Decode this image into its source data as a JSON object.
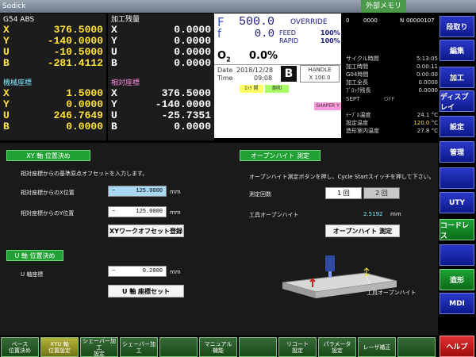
{
  "titlebar": {
    "app": "Sodick",
    "external_memory": "外部メモリ"
  },
  "coords": {
    "g54": {
      "header": "G54 ABS",
      "rows": [
        {
          "axis": "X",
          "value": "376.5000"
        },
        {
          "axis": "Y",
          "value": "-140.0000"
        },
        {
          "axis": "U",
          "value": "-10.5000"
        },
        {
          "axis": "B",
          "value": "-281.4112"
        }
      ]
    },
    "remaining": {
      "header": "加工残量",
      "rows": [
        {
          "axis": "X",
          "value": "0.0000"
        },
        {
          "axis": "Y",
          "value": "0.0000"
        },
        {
          "axis": "U",
          "value": "0.0000"
        },
        {
          "axis": "B",
          "value": "0.0000"
        }
      ]
    },
    "machine": {
      "header": "機械座標",
      "rows": [
        {
          "axis": "X",
          "value": "1.5000"
        },
        {
          "axis": "Y",
          "value": "0.0000"
        },
        {
          "axis": "U",
          "value": "246.7649"
        },
        {
          "axis": "B",
          "value": "0.0000"
        }
      ]
    },
    "relative": {
      "header": "相対座標",
      "rows": [
        {
          "axis": "X",
          "value": "376.5000"
        },
        {
          "axis": "Y",
          "value": "-140.0000"
        },
        {
          "axis": "U",
          "value": "-25.7351"
        },
        {
          "axis": "B",
          "value": "0.0000"
        }
      ]
    }
  },
  "feed": {
    "F_label": "F",
    "F_value": "500.0",
    "f_label": "f",
    "f_value": "0.0",
    "override": "OVERRIDE",
    "feed_label": "FEED",
    "feed_pct": "100%",
    "rapid_label": "RAPID",
    "rapid_pct": "100%",
    "o_label": "O",
    "o_sub": "2",
    "o_value": "0.0%",
    "date_label": "Date",
    "date_value": "2018/12/28",
    "time_label": "Time",
    "time_value": "09:08",
    "b_label": "B",
    "handle_label": "HANDLE",
    "handle_value": "X 100.0",
    "lock": "ﾛｯｸ 開",
    "sat": "飽和",
    "shaper": "SHAPER Y"
  },
  "right": {
    "c1": "0",
    "c2": "0000",
    "c3": "N",
    "c4": "00000107",
    "stats": [
      {
        "label": "サイクル時間",
        "value": "5:13:05"
      },
      {
        "label": "加工時間",
        "value": "0:00:11"
      },
      {
        "label": "G04時間",
        "value": "0:00:00"
      },
      {
        "label": "加工全長",
        "value": "0.0000"
      },
      {
        "label": "ﾌﾞﾛｯｸ残長",
        "value": "0.0000"
      }
    ],
    "sept_label": "SEPT",
    "sept_value": "OFF",
    "temps": [
      {
        "label": "ﾃｰﾌﾞﾙ温度",
        "value": "24.1",
        "unit": "°C"
      },
      {
        "label": "設定温度",
        "value": "120.0",
        "unit": "°C"
      },
      {
        "label": "造形室内温度",
        "value": "27.8",
        "unit": "°C"
      }
    ]
  },
  "side": [
    "段取り",
    "編集",
    "加工",
    "ディスプレイ",
    "設定",
    "管理",
    "",
    "UTY",
    "コードレス",
    "",
    "造形",
    "MDI",
    "ヘルプ"
  ],
  "xy": {
    "tab": "XY 軸 位置決め",
    "desc": "相対座標からの基準原点オフセットを入力します。",
    "x_label": "相対座標からのX位置",
    "x_sign": "−",
    "x_value": "125.0000",
    "y_label": "相対座標からのY位置",
    "y_sign": "−",
    "y_value": "125.0000",
    "unit": "mm",
    "register_btn": "XYワークオフセット登録"
  },
  "u": {
    "tab": "U 軸 位置決め",
    "label": "U 軸座標",
    "sign": "−",
    "value": "0.2000",
    "unit": "mm",
    "set_btn": "U 軸 座標セット"
  },
  "open": {
    "tab": "オープンハイト 測定",
    "desc": "オープンハイト測定ボタンを押し、Cycle Startスイッチを押して下さい。",
    "count_label": "測定回数",
    "opt1": "1 回",
    "opt2": "2 回",
    "tool_label": "工具オープンハイト",
    "tool_value": "2.5192",
    "tool_unit": "mm",
    "measure_btn": "オープンハイト 測定",
    "diagram_label": "工具オープンハイト"
  },
  "fkeys": [
    "ベース\n位置決め",
    "XYU 軸\n位置設定",
    "シェーバー加工\n設定",
    "シェーバー加工",
    "",
    "マニュアル\n機能",
    "",
    "リコート\n設定",
    "パラメータ\n設定",
    "レーザ補正",
    ""
  ]
}
